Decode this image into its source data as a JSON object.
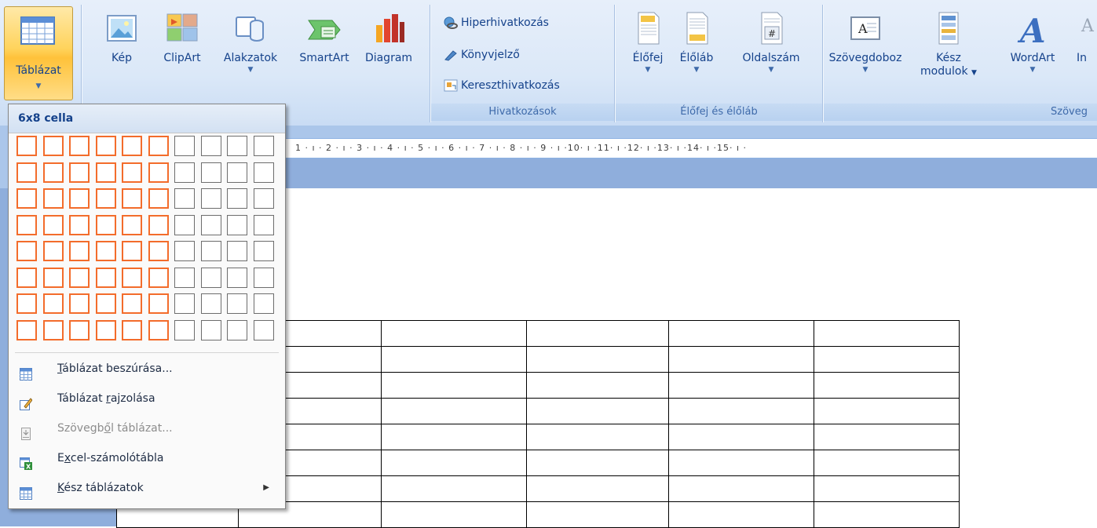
{
  "ribbon": {
    "tablazat": {
      "label": "Táblázat"
    },
    "illustrations": [
      {
        "label": "Kép",
        "icon": "picture-icon"
      },
      {
        "label": "ClipArt",
        "icon": "clipart-icon"
      },
      {
        "label": "Alakzatok",
        "icon": "shapes-icon"
      },
      {
        "label": "SmartArt",
        "icon": "smartart-icon"
      },
      {
        "label": "Diagram",
        "icon": "chart-icon"
      }
    ],
    "links": {
      "items": [
        {
          "label": "Hiperhivatkozás",
          "icon": "hyperlink-icon"
        },
        {
          "label": "Könyvjelző",
          "icon": "bookmark-icon"
        },
        {
          "label": "Kereszthivatkozás",
          "icon": "cross-reference-icon"
        }
      ],
      "group_label": "Hivatkozások"
    },
    "header_footer": {
      "items": [
        {
          "label": "Élőfej",
          "icon": "header-icon"
        },
        {
          "label": "Élőláb",
          "icon": "footer-icon"
        },
        {
          "label": "Oldalszám",
          "icon": "page-number-icon"
        }
      ],
      "group_label": "Élőfej és élőláb"
    },
    "text": {
      "items": [
        {
          "label": "Szövegdoboz",
          "icon": "textbox-icon"
        },
        {
          "label": "Kész",
          "label2": "modulok",
          "icon": "quick-parts-icon"
        },
        {
          "label": "WordArt",
          "icon": "wordart-icon"
        },
        {
          "label": "In",
          "icon": "dropcap-icon"
        }
      ],
      "group_label": "Szöveg"
    }
  },
  "ruler": {
    "text": "1 · ı · 2 · ı · 3 · ı · 4 · ı · 5 · ı · 6 · ı · 7 · ı · 8 · ı · 9 · ı ·10· ı ·11· ı ·12· ı ·13· ı ·14· ı ·15· ı ·"
  },
  "dropdown": {
    "header": "6x8 cella",
    "grid": {
      "columns": 10,
      "rows": 8,
      "selected_columns": 6,
      "selected_rows": 8
    },
    "menu": [
      {
        "label": "Táblázat beszúrása...",
        "u": "T",
        "rest": "áblázat beszúrása...",
        "icon": "insert-table-icon",
        "enabled": true,
        "submenu": false
      },
      {
        "label": "Táblázat rajzolása",
        "pre": "Táblázat ",
        "u": "r",
        "rest": "ajzolása",
        "icon": "draw-table-icon",
        "enabled": true,
        "submenu": false
      },
      {
        "label": "Szövegből táblázat...",
        "pre": "Szövegb",
        "u": "ő",
        "rest": "l táblázat...",
        "icon": "text-to-table-icon",
        "enabled": false,
        "submenu": false
      },
      {
        "label": "Excel-számolótábla",
        "pre": "E",
        "u": "x",
        "rest": "cel-számolótábla",
        "icon": "excel-spreadsheet-icon",
        "enabled": true,
        "submenu": false
      },
      {
        "label": "Kész táblázatok",
        "u": "K",
        "rest": "ész táblázatok",
        "icon": "quick-tables-icon",
        "enabled": true,
        "submenu": true
      }
    ]
  },
  "colors": {
    "accent": "#f36c2b",
    "ribbon": "#dbe8f8",
    "label": "#15428b"
  }
}
